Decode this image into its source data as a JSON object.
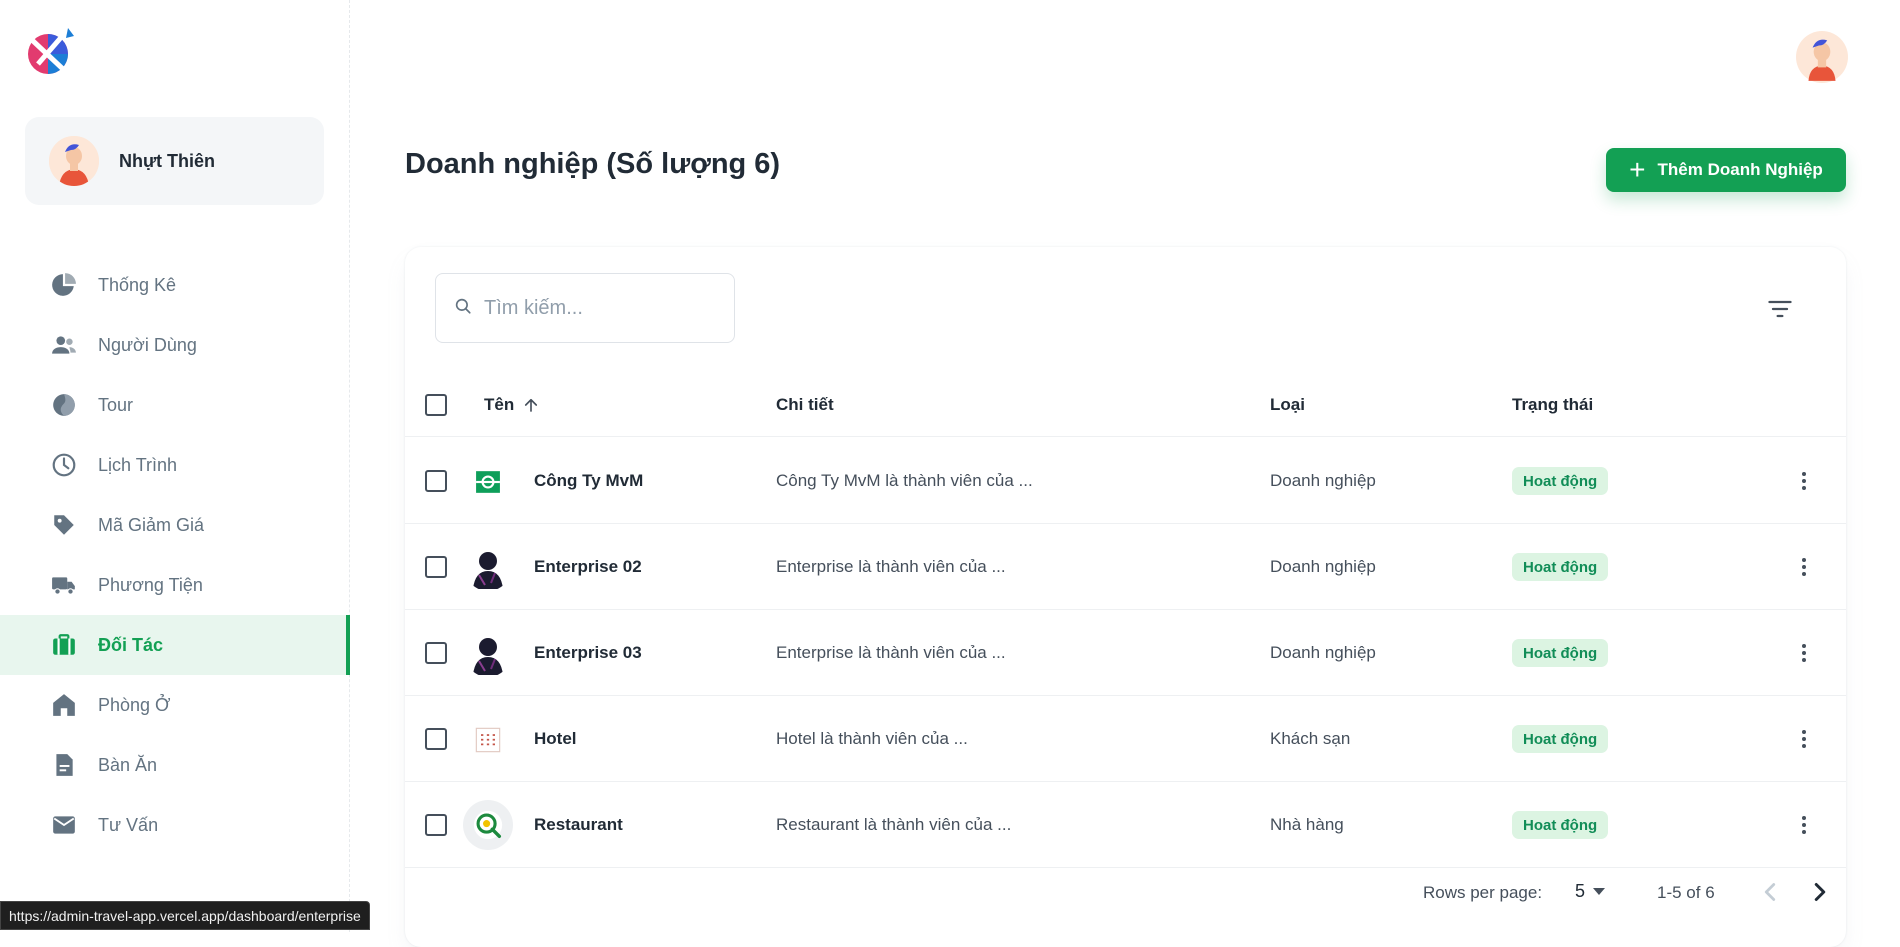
{
  "sidebar": {
    "profile_name": "Nhựt Thiên",
    "items": [
      {
        "label": "Thống Kê",
        "icon": "pie-chart-icon"
      },
      {
        "label": "Người Dùng",
        "icon": "users-icon"
      },
      {
        "label": "Tour",
        "icon": "globe-icon"
      },
      {
        "label": "Lịch Trình",
        "icon": "clock-icon"
      },
      {
        "label": "Mã Giảm Giá",
        "icon": "tag-icon"
      },
      {
        "label": "Phương Tiện",
        "icon": "truck-icon"
      },
      {
        "label": "Đối Tác",
        "icon": "briefcase-icon",
        "active": true
      },
      {
        "label": "Phòng Ở",
        "icon": "home-icon"
      },
      {
        "label": "Bàn Ăn",
        "icon": "document-icon"
      },
      {
        "label": "Tư Vấn",
        "icon": "mail-icon"
      }
    ]
  },
  "header": {
    "title": "Doanh nghiệp (Số lượng 6)",
    "add_button_label": "Thêm Doanh Nghiệp"
  },
  "search": {
    "placeholder": "Tìm kiếm..."
  },
  "table": {
    "columns": {
      "name": "Tên",
      "detail": "Chi tiết",
      "type": "Loại",
      "status": "Trạng thái"
    },
    "rows": [
      {
        "name": "Công Ty MvM",
        "detail": "Công Ty MvM là thành viên của ...",
        "type": "Doanh nghiệp",
        "status": "Hoat động",
        "avatar": "enterprise-logo-icon"
      },
      {
        "name": "Enterprise 02",
        "detail": "Enterprise là thành viên của ...",
        "type": "Doanh nghiệp",
        "status": "Hoat động",
        "avatar": "dark-figure-avatar"
      },
      {
        "name": "Enterprise 03",
        "detail": "Enterprise là thành viên của ...",
        "type": "Doanh nghiệp",
        "status": "Hoat động",
        "avatar": "dark-figure-avatar"
      },
      {
        "name": "Hotel",
        "detail": "Hotel là thành viên của ...",
        "type": "Khách sạn",
        "status": "Hoat động",
        "avatar": "hotel-logo-icon"
      },
      {
        "name": "Restaurant",
        "detail": "Restaurant là thành viên của ...",
        "type": "Nhà hàng",
        "status": "Hoat động",
        "avatar": "restaurant-logo-icon"
      }
    ]
  },
  "pagination": {
    "rows_per_page_label": "Rows per page:",
    "rows_per_page_value": "5",
    "range": "1-5 of 6"
  },
  "status_bar": {
    "url": "https://admin-travel-app.vercel.app/dashboard/enterprise"
  },
  "colors": {
    "accent": "#13a054",
    "badge_bg": "#dcf4e2",
    "badge_text": "#118d57"
  }
}
